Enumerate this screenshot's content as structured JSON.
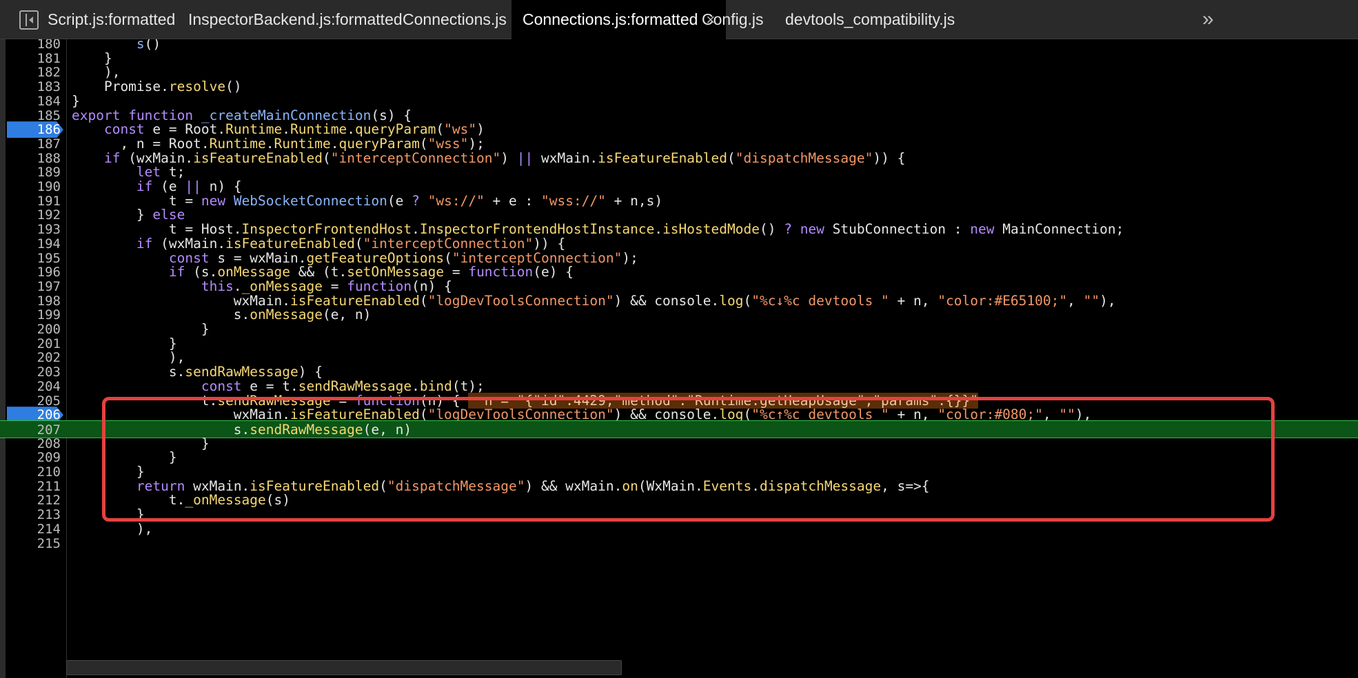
{
  "tabs": [
    {
      "label": "Script.js:formatted"
    },
    {
      "label": "InspectorBackend.js:formatted"
    },
    {
      "label": "Connections.js"
    },
    {
      "label": "Connections.js:formatted",
      "active": true,
      "close": "×"
    },
    {
      "label": "Config.js"
    },
    {
      "label": "devtools_compatibility.js"
    }
  ],
  "more_tabs": "»",
  "icons": {
    "sidebar_toggle": "sidebar-toggle-icon",
    "more": "double-chevron-right-icon",
    "breakpoint": "breakpoint-marker-icon"
  },
  "colors": {
    "breakpoint": "#2f7de1",
    "execution_line": "#0b5516",
    "highlight_box": "#e4423f",
    "keyword": "#b38bff",
    "string": "#f29766",
    "function": "#f5d774"
  },
  "lines": [
    {
      "n": "180",
      "text": "        s()"
    },
    {
      "n": "181",
      "text": "    }"
    },
    {
      "n": "182",
      "text": "    ),"
    },
    {
      "n": "183",
      "text": "    Promise.resolve()"
    },
    {
      "n": "184",
      "text": "}"
    },
    {
      "n": "185",
      "text": "export function _createMainConnection(s) {"
    },
    {
      "n": "186",
      "text": "    const e = Root.Runtime.Runtime.queryParam(\"ws\")",
      "breakpoint": true
    },
    {
      "n": "187",
      "text": "      , n = Root.Runtime.Runtime.queryParam(\"wss\");"
    },
    {
      "n": "188",
      "text": "    if (wxMain.isFeatureEnabled(\"interceptConnection\") || wxMain.isFeatureEnabled(\"dispatchMessage\")) {"
    },
    {
      "n": "189",
      "text": "        let t;"
    },
    {
      "n": "190",
      "text": "        if (e || n) {"
    },
    {
      "n": "191",
      "text": "            t = new WebSocketConnection(e ? \"ws://\" + e : \"wss://\" + n,s)"
    },
    {
      "n": "192",
      "text": "        } else"
    },
    {
      "n": "193",
      "text": "            t = Host.InspectorFrontendHost.InspectorFrontendHostInstance.isHostedMode() ? new StubConnection : new MainConnection;"
    },
    {
      "n": "194",
      "text": "        if (wxMain.isFeatureEnabled(\"interceptConnection\")) {"
    },
    {
      "n": "195",
      "text": "            const s = wxMain.getFeatureOptions(\"interceptConnection\");"
    },
    {
      "n": "196",
      "text": "            if (s.onMessage && (t.setOnMessage = function(e) {"
    },
    {
      "n": "197",
      "text": "                this._onMessage = function(n) {"
    },
    {
      "n": "198",
      "text": "                    wxMain.isFeatureEnabled(\"logDevToolsConnection\") && console.log(\"%c↓%c devtools \" + n, \"color:#E65100;\", \"\"),"
    },
    {
      "n": "199",
      "text": "                    s.onMessage(e, n)"
    },
    {
      "n": "200",
      "text": "                }"
    },
    {
      "n": "201",
      "text": "            }"
    },
    {
      "n": "202",
      "text": "            ),"
    },
    {
      "n": "203",
      "text": "            s.sendRawMessage) {"
    },
    {
      "n": "204",
      "text": "                const e = t.sendRawMessage.bind(t);"
    },
    {
      "n": "205",
      "text": "                t.sendRawMessage = function(n) {",
      "inline_value": "n = \"{\"id\":4429,\"method\":\"Runtime.getHeapUsage\",\"params\":{}}\""
    },
    {
      "n": "206",
      "text": "                    wxMain.isFeatureEnabled(\"logDevToolsConnection\") && console.log(\"%c↑%c devtools \" + n, \"color:#080;\", \"\"),",
      "breakpoint": true
    },
    {
      "n": "207",
      "text": "                    s.sendRawMessage(e, n)",
      "execution": true
    },
    {
      "n": "208",
      "text": "                }"
    },
    {
      "n": "209",
      "text": "            }"
    },
    {
      "n": "210",
      "text": "        }"
    },
    {
      "n": "211",
      "text": "        return wxMain.isFeatureEnabled(\"dispatchMessage\") && wxMain.on(WxMain.Events.dispatchMessage, s=>{"
    },
    {
      "n": "212",
      "text": "            t._onMessage(s)"
    },
    {
      "n": "213",
      "text": "        }"
    },
    {
      "n": "214",
      "text": "        ),"
    },
    {
      "n": "215",
      "text": ""
    }
  ]
}
